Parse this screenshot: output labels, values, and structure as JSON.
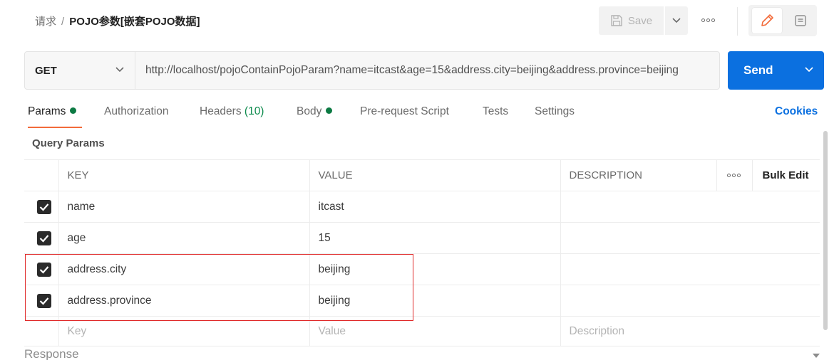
{
  "breadcrumb": {
    "parent": "请求",
    "separator": "/",
    "current": "POJO参数[嵌套POJO数据]"
  },
  "toolbar": {
    "save_label": "Save",
    "save_icon": "save-icon",
    "more_icon": "more-horizontal-icon",
    "edit_icon": "pencil-icon",
    "doc_icon": "document-icon"
  },
  "request": {
    "method": "GET",
    "url": "http://localhost/pojoContainPojoParam?name=itcast&age=15&address.city=beijing&address.province=beijing",
    "send_label": "Send"
  },
  "tabs": [
    {
      "label": "Params",
      "indicator": true,
      "active": true
    },
    {
      "label": "Authorization"
    },
    {
      "label": "Headers",
      "count": "(10)"
    },
    {
      "label": "Body",
      "indicator": true
    },
    {
      "label": "Pre-request Script"
    },
    {
      "label": "Tests"
    },
    {
      "label": "Settings"
    }
  ],
  "cookies_label": "Cookies",
  "query_params": {
    "title": "Query Params",
    "columns": [
      "KEY",
      "VALUE",
      "DESCRIPTION"
    ],
    "bulk_edit": "Bulk Edit",
    "rows": [
      {
        "checked": true,
        "key": "name",
        "value": "itcast",
        "description": ""
      },
      {
        "checked": true,
        "key": "age",
        "value": "15",
        "description": ""
      },
      {
        "checked": true,
        "key": "address.city",
        "value": "beijing",
        "description": ""
      },
      {
        "checked": true,
        "key": "address.province",
        "value": "beijing",
        "description": ""
      }
    ],
    "placeholders": {
      "key": "Key",
      "value": "Value",
      "description": "Description"
    }
  },
  "response_label": "Response",
  "colors": {
    "accent": "#0b70e0",
    "tab_underline": "#f26b3a",
    "indicator_green": "#0c7a43",
    "highlight_red": "#e02a2a"
  }
}
